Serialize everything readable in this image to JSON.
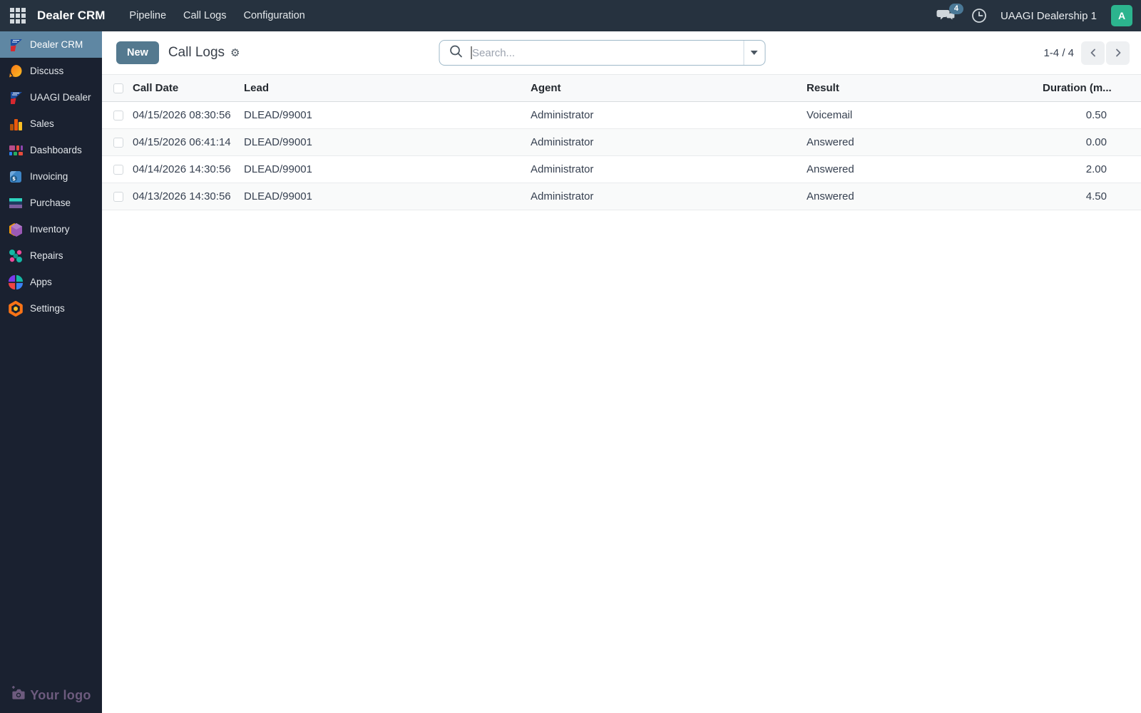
{
  "navbar": {
    "app_name": "Dealer CRM",
    "menu_items": [
      {
        "label": "Pipeline"
      },
      {
        "label": "Call Logs"
      },
      {
        "label": "Configuration"
      }
    ],
    "messages_badge": "4",
    "company_name": "UAAGI Dealership 1",
    "avatar_letter": "A"
  },
  "sidebar": {
    "items": [
      {
        "label": "Dealer CRM",
        "icon": "dealer-crm-logo",
        "active": true
      },
      {
        "label": "Discuss",
        "icon": "discuss"
      },
      {
        "label": "UAAGI Dealer",
        "icon": "uaagi-dealer-logo"
      },
      {
        "label": "Sales",
        "icon": "sales"
      },
      {
        "label": "Dashboards",
        "icon": "dashboards"
      },
      {
        "label": "Invoicing",
        "icon": "invoicing"
      },
      {
        "label": "Purchase",
        "icon": "purchase"
      },
      {
        "label": "Inventory",
        "icon": "inventory"
      },
      {
        "label": "Repairs",
        "icon": "repairs"
      },
      {
        "label": "Apps",
        "icon": "apps"
      },
      {
        "label": "Settings",
        "icon": "settings"
      }
    ],
    "footer_logo_text": "Your logo"
  },
  "control_panel": {
    "new_button_label": "New",
    "page_title": "Call Logs",
    "search_placeholder": "Search...",
    "pager_text": "1-4 / 4"
  },
  "table": {
    "columns": [
      "Call Date",
      "Lead",
      "Agent",
      "Result",
      "Duration (m..."
    ],
    "rows": [
      {
        "call_date": "04/15/2026 08:30:56",
        "lead": "DLEAD/99001",
        "agent": "Administrator",
        "result": "Voicemail",
        "duration": "0.50"
      },
      {
        "call_date": "04/15/2026 06:41:14",
        "lead": "DLEAD/99001",
        "agent": "Administrator",
        "result": "Answered",
        "duration": "0.00"
      },
      {
        "call_date": "04/14/2026 14:30:56",
        "lead": "DLEAD/99001",
        "agent": "Administrator",
        "result": "Answered",
        "duration": "2.00"
      },
      {
        "call_date": "04/13/2026 14:30:56",
        "lead": "DLEAD/99001",
        "agent": "Administrator",
        "result": "Answered",
        "duration": "4.50"
      }
    ]
  },
  "colors": {
    "navbar_bg": "#26323f",
    "sidebar_bg": "#1a2130",
    "active_item_bg": "#5f87a3",
    "primary_button_bg": "#54798f",
    "avatar_bg": "#2cb48e",
    "messages_badge_bg": "#4a7896",
    "footer_logo_color": "#6d5b7e"
  }
}
